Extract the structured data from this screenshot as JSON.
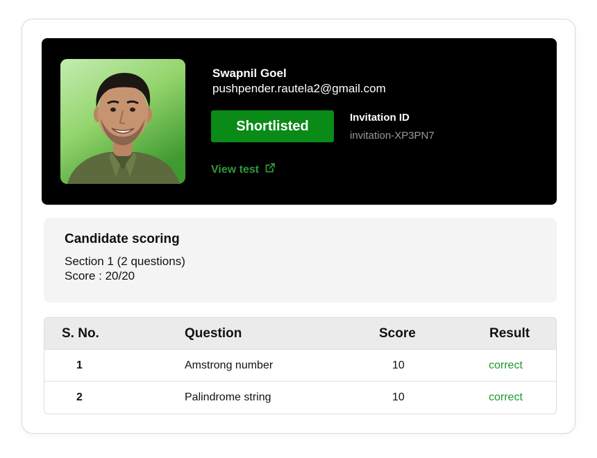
{
  "candidate": {
    "name": "Swapnil Goel",
    "email": "pushpender.rautela2@gmail.com",
    "status": "Shortlisted",
    "invitation_label": "Invitation ID",
    "invitation_id": "invitation-XP3PN7",
    "view_test_label": "View test"
  },
  "scoring": {
    "title": "Candidate scoring",
    "section": "Section 1 (2 questions)",
    "score": "Score : 20/20"
  },
  "table": {
    "headers": [
      "S. No.",
      "Question",
      "Score",
      "Result"
    ],
    "rows": [
      {
        "sno": "1",
        "question": "Amstrong number",
        "score": "10",
        "result": "correct"
      },
      {
        "sno": "2",
        "question": "Palindrome string",
        "score": "10",
        "result": "correct"
      }
    ]
  },
  "colors": {
    "status_green": "#0a8a16",
    "link_green": "#2f9a3a",
    "result_green": "#1a9b25",
    "hero_bg": "#000000"
  },
  "icons": {
    "view_test": "external-link-icon"
  }
}
